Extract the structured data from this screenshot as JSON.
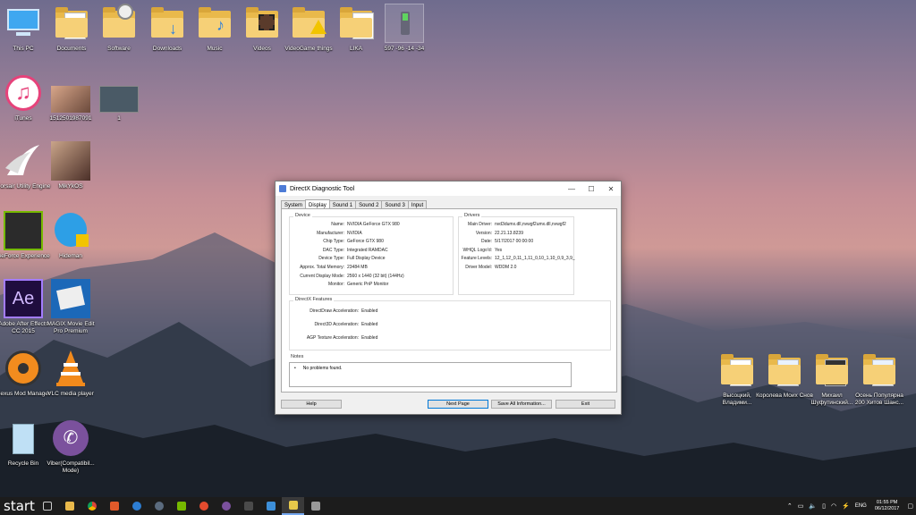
{
  "desktop_icons": {
    "this_pc": "This PC",
    "documents": "Documents",
    "software": "Software",
    "downloads": "Downloads",
    "music": "Music",
    "videos": "Videos",
    "videogame": "VideoGame things",
    "lika": "LIKA",
    "phone": "597 -96 -14 -34",
    "itunes": "iTunes",
    "photo1": "1512501987091",
    "shot1": "1",
    "corsair": "Corsair Utility Engine",
    "mikykos": "MikYkOS",
    "geforce": "GeForce Experience",
    "hideman": "Hideman",
    "ae": "Adobe After Effects CC 2015",
    "magix": "MAGIX Movie Edit Pro Premium",
    "nexus": "Nexus Mod Manager",
    "vlc": "VLC media player",
    "recycle": "Recycle Bin",
    "viber": "Viber(Compatibil... Mode)",
    "f1": "Высоцкий, Владими...",
    "f2": "Королева Моих Снов",
    "f3": "Михаил Шуфутинский...",
    "f4": "Осень Популярна 200 Хитов Шанс..."
  },
  "dxdiag": {
    "title": "DirectX Diagnostic Tool",
    "tabs": [
      "System",
      "Display",
      "Sound 1",
      "Sound 2",
      "Sound 3",
      "Input"
    ],
    "device_title": "Device",
    "device": [
      {
        "k": "Name:",
        "v": "NVIDIA GeForce GTX 980"
      },
      {
        "k": "Manufacturer:",
        "v": "NVIDIA"
      },
      {
        "k": "Chip Type:",
        "v": "GeForce GTX 980"
      },
      {
        "k": "DAC Type:",
        "v": "Integrated RAMDAC"
      },
      {
        "k": "Device Type:",
        "v": "Full Display Device"
      },
      {
        "k": "Approx. Total Memory:",
        "v": "23484 MB"
      },
      {
        "k": "Current Display Mode:",
        "v": "2560 x 1440 (32 bit) (144Hz)"
      },
      {
        "k": "Monitor:",
        "v": "Generic PnP Monitor"
      }
    ],
    "drivers_title": "Drivers",
    "drivers": [
      {
        "k": "Main Driver:",
        "v": "nvd3dumx.dll,nvwgf2umx.dll,nvwgf2"
      },
      {
        "k": "Version:",
        "v": "22.21.13.8239"
      },
      {
        "k": "Date:",
        "v": "5/17/2017 00:00:00"
      },
      {
        "k": "WHQL Logo'd:",
        "v": "Yes"
      },
      {
        "k": "Feature Levels:",
        "v": "12_1,12_0,11_1,11_0,10_1,10_0,9_3,9_"
      },
      {
        "k": "Driver Model:",
        "v": "WDDM 2.0"
      }
    ],
    "features_title": "DirectX Features",
    "features": [
      {
        "k": "DirectDraw Acceleration:",
        "v": "Enabled"
      },
      {
        "k": "Direct3D Acceleration:",
        "v": "Enabled"
      },
      {
        "k": "AGP Texture Acceleration:",
        "v": "Enabled"
      }
    ],
    "notes_title": "Notes",
    "notes": "No problems found.",
    "buttons": {
      "help": "Help",
      "next": "Next Page",
      "save": "Save All Information...",
      "exit": "Exit"
    }
  },
  "taskbar": {
    "start": "start",
    "lang": "ENG",
    "time": "01:55 PM",
    "date": "06/12/2017"
  }
}
